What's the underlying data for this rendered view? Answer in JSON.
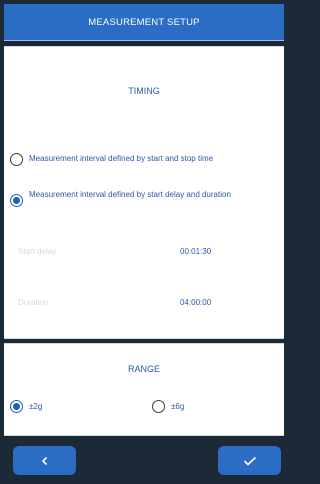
{
  "header": {
    "title": "MEASUREMENT SETUP"
  },
  "timing": {
    "title": "TIMING",
    "options": [
      {
        "label": "Measurement interval defined by start and stop time",
        "selected": false
      },
      {
        "label": "Measurement interval defined by start delay and duration",
        "selected": true
      }
    ],
    "start_delay": {
      "label": "Start delay",
      "value": "00:01:30"
    },
    "duration": {
      "label": "Duration",
      "value": "04:00:00"
    }
  },
  "range": {
    "title": "RANGE",
    "options": [
      {
        "label": "±2g",
        "selected": true
      },
      {
        "label": "±6g",
        "selected": false
      }
    ]
  },
  "footer": {
    "back_icon": "chevron-left-icon",
    "confirm_icon": "check-icon"
  },
  "colors": {
    "accent": "#2b6cc4",
    "text_blue": "#2d5aa5",
    "background": "#1c2a38"
  }
}
